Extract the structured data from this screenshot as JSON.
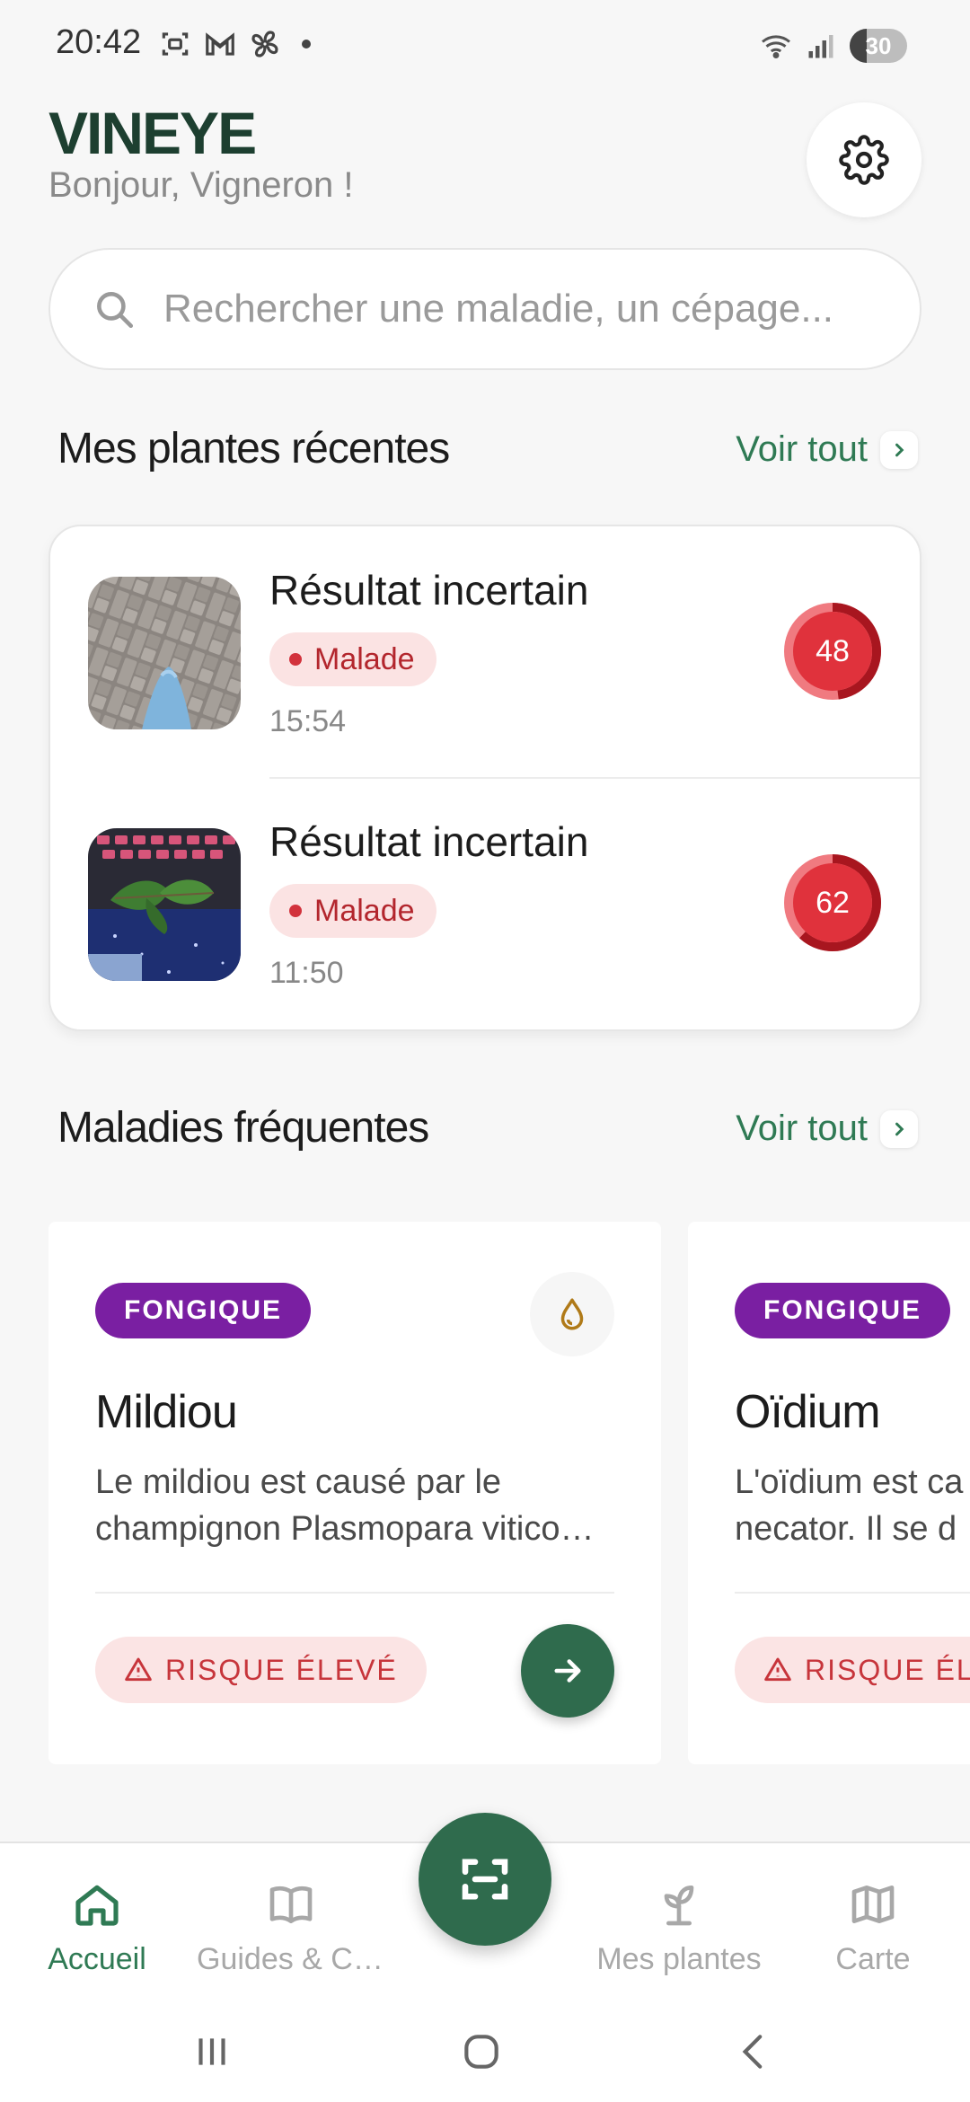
{
  "status_bar": {
    "time": "20:42",
    "battery": "30",
    "battery_level": 0.3
  },
  "header": {
    "app_title": "VINEYE",
    "greeting": "Bonjour, Vigneron !",
    "settings_icon": "gear-icon"
  },
  "search": {
    "placeholder": "Rechercher une maladie, un cépage..."
  },
  "recent": {
    "title": "Mes plantes récentes",
    "see_all": "Voir tout",
    "items": [
      {
        "title": "Résultat incertain",
        "status": "Malade",
        "time": "15:54",
        "score": "48",
        "score_value": 48
      },
      {
        "title": "Résultat incertain",
        "status": "Malade",
        "time": "11:50",
        "score": "62",
        "score_value": 62
      }
    ]
  },
  "diseases": {
    "title": "Maladies fréquentes",
    "see_all": "Voir tout",
    "cards": [
      {
        "type": "FONGIQUE",
        "name": "Mildiou",
        "desc_line1": "Le mildiou est causé par le",
        "desc_line2": "champignon Plasmopara vitico…",
        "risk": "RISQUE ÉLEVÉ",
        "icon": "water-drop-icon"
      },
      {
        "type": "FONGIQUE",
        "name": "Oïdium",
        "desc_line1": "L'oïdium est ca",
        "desc_line2": "necator. Il se d",
        "risk": "RISQUE ÉLE"
      }
    ]
  },
  "bottom_nav": {
    "items": [
      {
        "label": "Accueil",
        "icon": "home-icon",
        "active": true
      },
      {
        "label": "Guides & Co...",
        "icon": "book-icon"
      },
      {
        "label": "Mes plantes",
        "icon": "sprout-icon"
      },
      {
        "label": "Carte",
        "icon": "map-icon"
      }
    ],
    "scan_icon": "scan-icon"
  },
  "colors": {
    "brand_green": "#2f6b4d",
    "accent_green": "#2f7a54",
    "danger": "#d2323c",
    "fungal_purple": "#7a1fa2"
  }
}
